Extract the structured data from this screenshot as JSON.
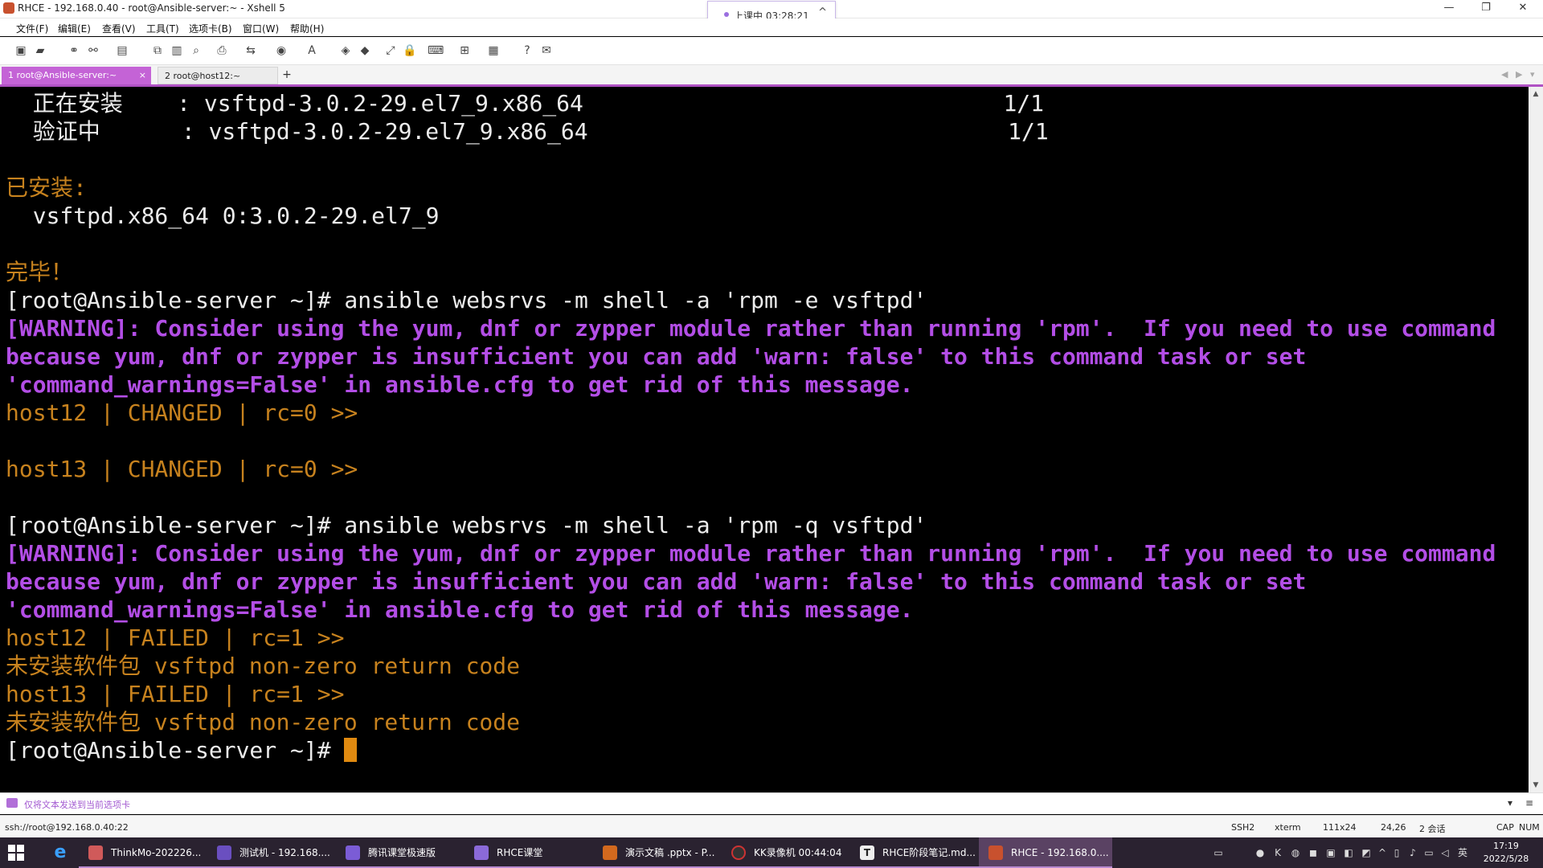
{
  "window": {
    "title": "RHCE - 192.168.0.40 - root@Ansible-server:~ - Xshell 5",
    "controls": {
      "minimize": "—",
      "restore": "❐",
      "close": "✕"
    }
  },
  "class_timer": {
    "label": "上课中 03:28:21",
    "caret": "^"
  },
  "menu": [
    "文件(F)",
    "编辑(E)",
    "查看(V)",
    "工具(T)",
    "选项卡(B)",
    "窗口(W)",
    "帮助(H)"
  ],
  "tabs": [
    {
      "label": "1 root@Ansible-server:~",
      "close": "×"
    },
    {
      "label": "2 root@host12:~"
    }
  ],
  "tab_add": "+",
  "terminal": {
    "lines": [
      {
        "text": "  正在安装    : vsftpd-3.0.2-29.el7_9.x86_64                               1/1",
        "color": "white"
      },
      {
        "text": "  验证中      : vsftpd-3.0.2-29.el7_9.x86_64                               1/1",
        "color": "white"
      },
      {
        "text": "",
        "color": "white"
      },
      {
        "text": "已安装:",
        "color": "orange"
      },
      {
        "text": "  vsftpd.x86_64 0:3.0.2-29.el7_9",
        "color": "white"
      },
      {
        "text": "",
        "color": "white"
      },
      {
        "text": "完毕！",
        "color": "orange"
      },
      {
        "text": "[root@Ansible-server ~]# ansible websrvs -m shell -a 'rpm -e vsftpd'",
        "color": "white"
      },
      {
        "text": "[WARNING]: Consider using the yum, dnf or zypper module rather than running 'rpm'.  If you need to use command",
        "color": "purple"
      },
      {
        "text": "because yum, dnf or zypper is insufficient you can add 'warn: false' to this command task or set",
        "color": "purple"
      },
      {
        "text": "'command_warnings=False' in ansible.cfg to get rid of this message.",
        "color": "purple"
      },
      {
        "text": "host12 | CHANGED | rc=0 >>",
        "color": "orange"
      },
      {
        "text": "",
        "color": "white"
      },
      {
        "text": "host13 | CHANGED | rc=0 >>",
        "color": "orange"
      },
      {
        "text": "",
        "color": "white"
      },
      {
        "text": "[root@Ansible-server ~]# ansible websrvs -m shell -a 'rpm -q vsftpd'",
        "color": "white"
      },
      {
        "text": "[WARNING]: Consider using the yum, dnf or zypper module rather than running 'rpm'.  If you need to use command",
        "color": "purple"
      },
      {
        "text": "because yum, dnf or zypper is insufficient you can add 'warn: false' to this command task or set",
        "color": "purple"
      },
      {
        "text": "'command_warnings=False' in ansible.cfg to get rid of this message.",
        "color": "purple"
      },
      {
        "text": "host12 | FAILED | rc=1 >>",
        "color": "orange"
      },
      {
        "text": "未安装软件包 vsftpd non-zero return code",
        "color": "orange"
      },
      {
        "text": "host13 | FAILED | rc=1 >>",
        "color": "orange"
      },
      {
        "text": "未安装软件包 vsftpd non-zero return code",
        "color": "orange"
      }
    ],
    "prompt": "[root@Ansible-server ~]# "
  },
  "sendbar": {
    "text": "仅将文本发送到当前选项卡"
  },
  "status": {
    "connection": "ssh://root@192.168.0.40:22",
    "protocol": "SSH2",
    "term": "xterm",
    "size": "111x24",
    "cursor_pos": "24,26",
    "sessions": "2 会话",
    "cap": "CAP",
    "num": "NUM"
  },
  "taskbar": {
    "items": [
      {
        "label": "ThinkMo-202226...",
        "color": "#d05a5a"
      },
      {
        "label": "测试机 - 192.168....",
        "color": "#6a4fc0"
      },
      {
        "label": "腾讯课堂极速版",
        "color": "#7b5cd6"
      },
      {
        "label": "RHCE课堂",
        "color": "#8b6ad8"
      },
      {
        "label": "演示文稿 .pptx - P...",
        "color": "#d2691e"
      },
      {
        "label": "KK录像机 00:44:04",
        "color": "#333"
      },
      {
        "label": "RHCE阶段笔记.md...",
        "color": "#444"
      },
      {
        "label": "RHCE - 192.168.0....",
        "color": "#c8512e"
      }
    ],
    "ime": "英",
    "time": "17:19",
    "date": "2022/5/28"
  },
  "colors": {
    "white": "#ececec",
    "orange": "#c7821e",
    "purple": "#b34ee6",
    "tab_accent": "#c463d6"
  }
}
